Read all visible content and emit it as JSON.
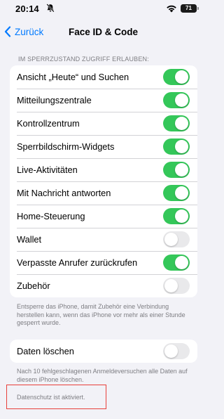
{
  "status_bar": {
    "time": "20:14",
    "battery": "71"
  },
  "nav": {
    "back_label": "Zurück",
    "title": "Face ID & Code"
  },
  "section_header": "IM SPERRZUSTAND ZUGRIFF ERLAUBEN:",
  "access_items": [
    {
      "label": "Ansicht „Heute“ und Suchen",
      "on": true
    },
    {
      "label": "Mitteilungszentrale",
      "on": true
    },
    {
      "label": "Kontrollzentrum",
      "on": true
    },
    {
      "label": "Sperrbildschirm-Widgets",
      "on": true
    },
    {
      "label": "Live-Aktivitäten",
      "on": true
    },
    {
      "label": "Mit Nachricht antworten",
      "on": true
    },
    {
      "label": "Home-Steuerung",
      "on": true
    },
    {
      "label": "Wallet",
      "on": false
    },
    {
      "label": "Verpasste Anrufer zurückrufen",
      "on": true
    },
    {
      "label": "Zubehör",
      "on": false
    }
  ],
  "accessory_footer": "Entsperre das iPhone, damit Zubehör eine Verbindung herstellen kann, wenn das iPhone vor mehr als einer Stunde gesperrt wurde.",
  "erase_data": {
    "label": "Daten löschen",
    "on": false
  },
  "erase_footer": "Nach 10 fehlgeschlagenen Anmeldeversuchen alle Daten auf diesem iPhone löschen.",
  "privacy_note": "Datenschutz ist aktiviert.",
  "colors": {
    "accent": "#007aff",
    "toggle_on": "#34c759",
    "toggle_off": "#e9e9eb",
    "highlight_box": "#e8403b"
  }
}
